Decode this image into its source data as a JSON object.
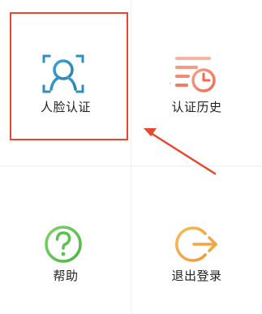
{
  "menu": {
    "face_auth": {
      "label": "人脸认证",
      "icon": "face-scan-icon",
      "color": "#2e8fbf"
    },
    "auth_history": {
      "label": "认证历史",
      "icon": "history-clock-icon",
      "color": "#f0705a"
    },
    "help": {
      "label": "帮助",
      "icon": "question-circle-icon",
      "color": "#5cc24f"
    },
    "logout": {
      "label": "退出登录",
      "icon": "exit-arrow-icon",
      "color": "#f2a640"
    }
  },
  "annotation": {
    "highlight_color": "#e8472f",
    "target": "face_auth"
  }
}
